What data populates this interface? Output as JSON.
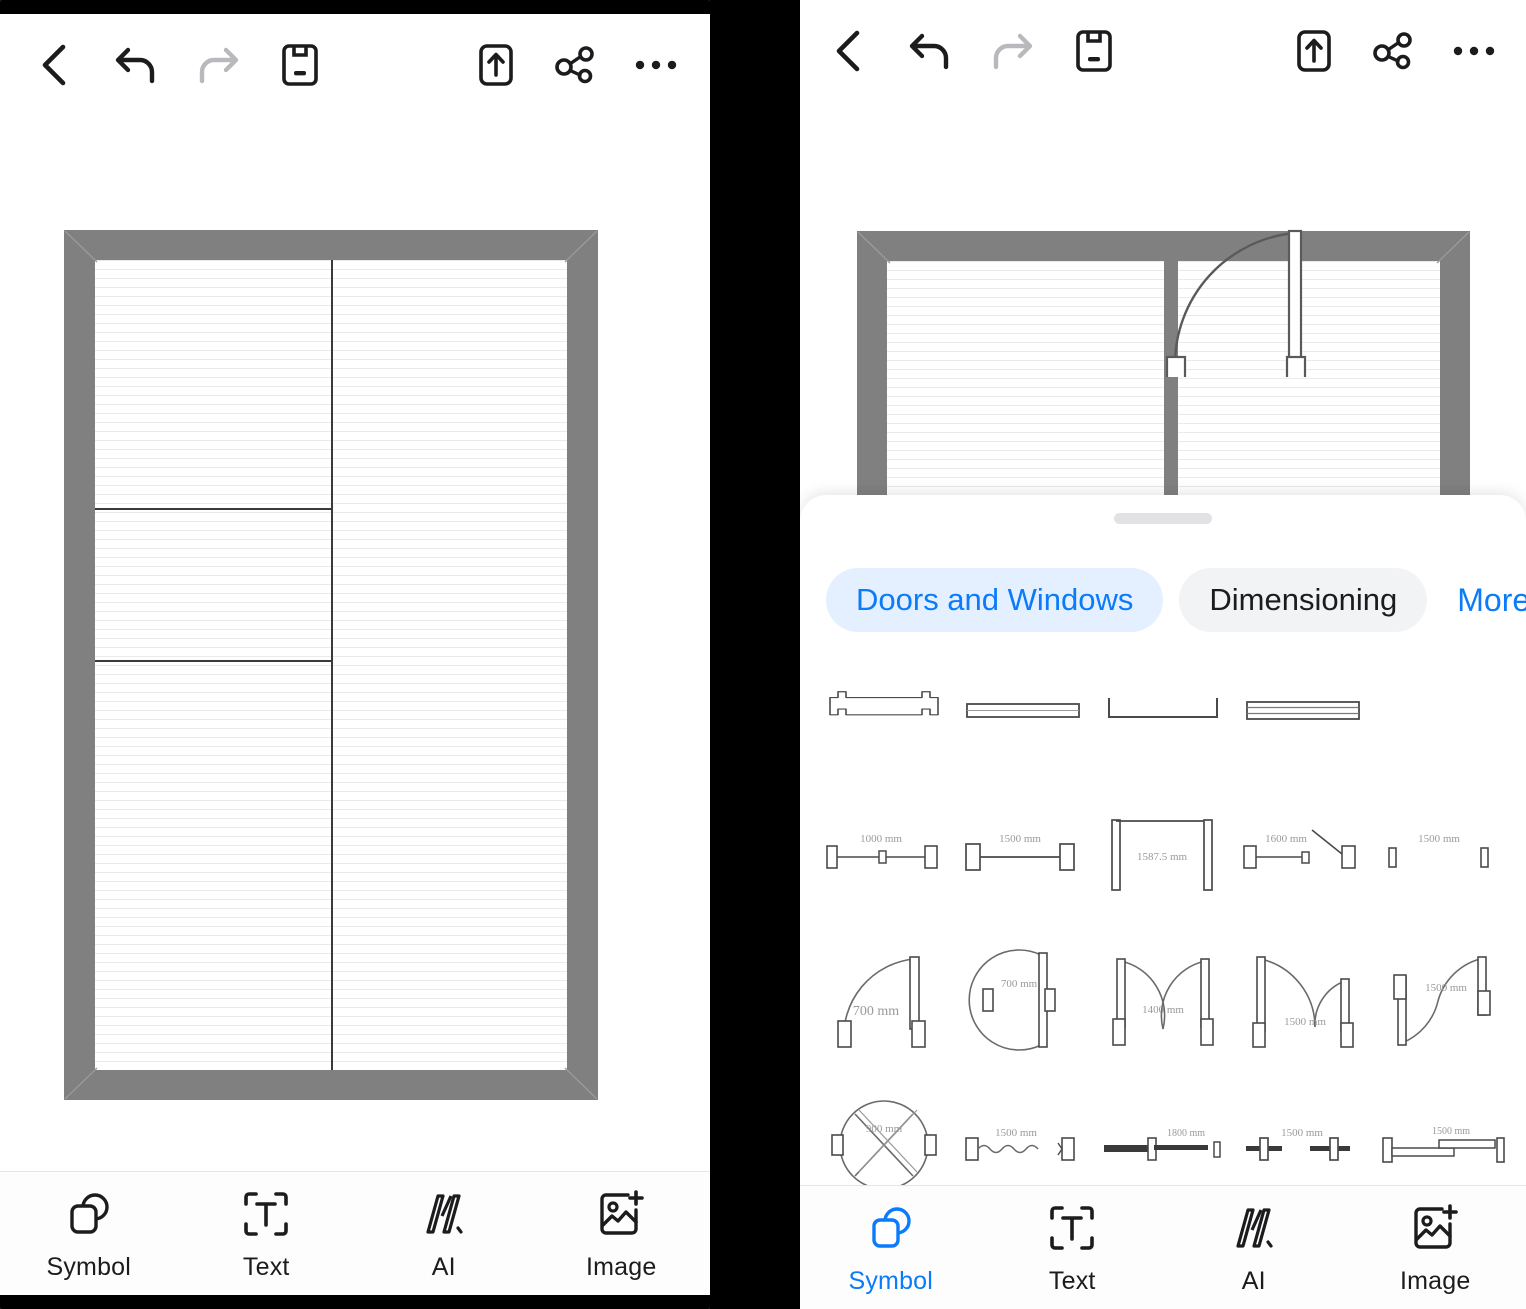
{
  "app": {
    "accent_color": "#0a7cfa",
    "wall_color": "#808080",
    "chip_inactive_bg": "#f2f3f5",
    "chip_active_bg": "#e4f0ff"
  },
  "toolbar": {
    "back_label": "Back",
    "undo_label": "Undo",
    "redo_label": "Redo",
    "save_label": "Save",
    "export_label": "Export",
    "share_label": "Share",
    "more_label": "More options",
    "icons": [
      "chevron-left-icon",
      "undo-icon",
      "redo-icon",
      "save-icon",
      "export-icon",
      "share-icon",
      "ellipsis-icon"
    ]
  },
  "bottom_nav": {
    "items": [
      {
        "label": "Symbol",
        "icon": "symbol-icon",
        "active_left": false,
        "active_right": true
      },
      {
        "label": "Text",
        "icon": "text-icon",
        "active_left": false,
        "active_right": false
      },
      {
        "label": "AI",
        "icon": "ai-icon",
        "active_left": false,
        "active_right": false
      },
      {
        "label": "Image",
        "icon": "image-icon",
        "active_left": false,
        "active_right": false
      }
    ]
  },
  "sheet": {
    "grabber_label": "Drag handle",
    "tabs": [
      {
        "label": "",
        "state": "partial"
      },
      {
        "label": "Doors and Windows",
        "state": "active"
      },
      {
        "label": "Dimensioning",
        "state": "inactive"
      },
      {
        "label": "More",
        "state": "link"
      }
    ]
  },
  "symbols": {
    "rows": [
      [
        {
          "name": "window-recessed",
          "dim": ""
        },
        {
          "name": "window-double-line",
          "dim": ""
        },
        {
          "name": "opening-bracket",
          "dim": ""
        },
        {
          "name": "window-triple-line",
          "dim": ""
        }
      ],
      [
        {
          "name": "dimension-double-stop",
          "dim": "1000 mm"
        },
        {
          "name": "dimension-single-span",
          "dim": "1500 mm"
        },
        {
          "name": "opening-span-bracket",
          "dim": "1587.5 mm"
        },
        {
          "name": "dimension-angled-leader",
          "dim": "1600 mm"
        },
        {
          "name": "dimension-gap-posts",
          "dim": "1500 mm"
        }
      ],
      [
        {
          "name": "door-single-swing-left",
          "dim": "700 mm"
        },
        {
          "name": "door-single-swing-right",
          "dim": "700 mm"
        },
        {
          "name": "door-double-swing-inward",
          "dim": "1400 mm"
        },
        {
          "name": "door-double-swing-uneven",
          "dim": "1500 mm"
        },
        {
          "name": "door-double-swing-opposite",
          "dim": "1500 mm"
        }
      ],
      [
        {
          "name": "revolving-door",
          "dim": "900 mm"
        },
        {
          "name": "accordion-door",
          "dim": "1500 mm"
        },
        {
          "name": "sliding-door-single",
          "dim": "1800 mm"
        },
        {
          "name": "sliding-door-pocket",
          "dim": "1500 mm"
        },
        {
          "name": "sliding-door-bypass",
          "dim": "1500 mm"
        }
      ]
    ]
  },
  "floor_plan_left": {
    "title": "Floor plan canvas",
    "rooms": [
      "room-upper-left",
      "room-middle-left",
      "room-lower-left",
      "room-right"
    ]
  },
  "floor_plan_right": {
    "title": "Floor plan canvas with placed door",
    "placed_symbol": "door-single-swing"
  }
}
